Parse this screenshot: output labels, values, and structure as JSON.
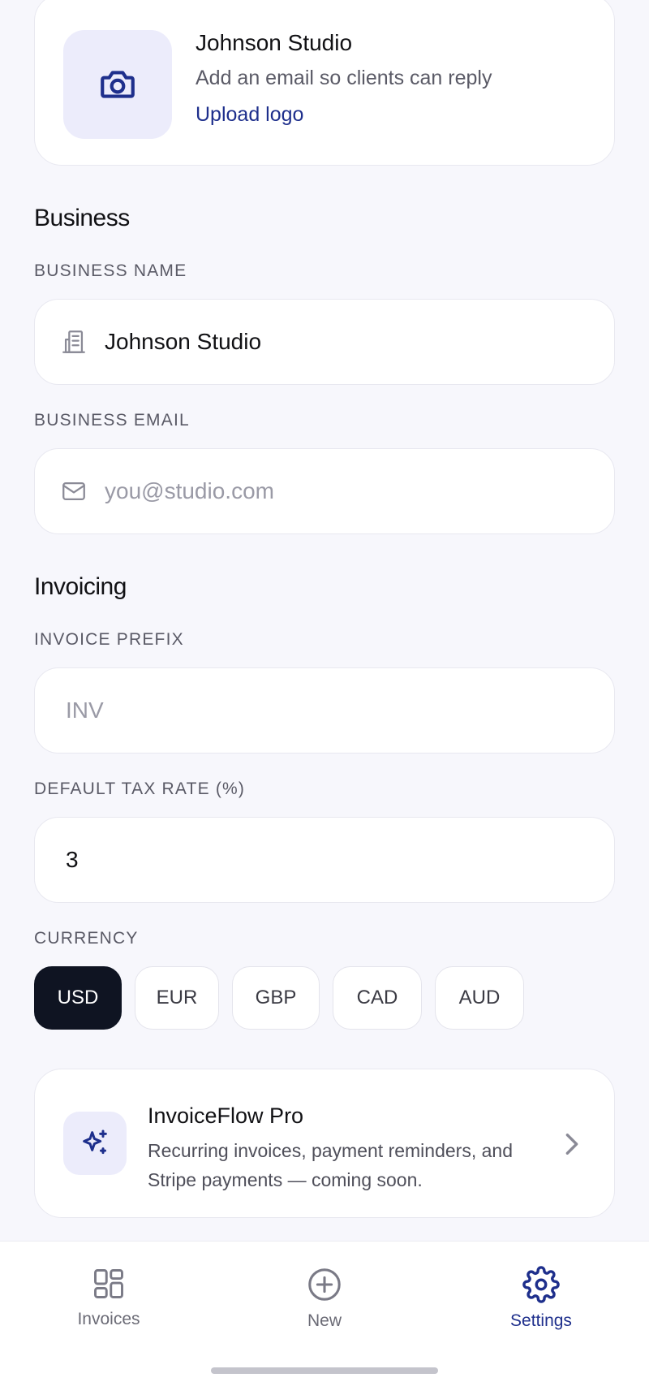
{
  "profile": {
    "name": "Johnson Studio",
    "subtitle": "Add an email so clients can reply",
    "upload_label": "Upload logo",
    "icon": "camera-icon"
  },
  "business": {
    "section_title": "Business",
    "name_label": "BUSINESS NAME",
    "name_value": "Johnson Studio",
    "name_icon": "building-icon",
    "email_label": "BUSINESS EMAIL",
    "email_value": "",
    "email_placeholder": "you@studio.com",
    "email_icon": "mail-icon"
  },
  "invoicing": {
    "section_title": "Invoicing",
    "prefix_label": "INVOICE PREFIX",
    "prefix_value": "",
    "prefix_placeholder": "INV",
    "tax_label": "DEFAULT TAX RATE (%)",
    "tax_value": "3",
    "currency_label": "CURRENCY",
    "currencies": [
      "USD",
      "EUR",
      "GBP",
      "CAD",
      "AUD"
    ],
    "selected_currency": "USD"
  },
  "pro": {
    "title": "InvoiceFlow Pro",
    "description": "Recurring invoices, payment reminders, and Stripe payments — coming soon.",
    "icon": "sparkle-icon"
  },
  "tabbar": {
    "tabs": [
      {
        "label": "Invoices",
        "icon": "grid-icon",
        "active": false
      },
      {
        "label": "New",
        "icon": "plus-circle-icon",
        "active": false
      },
      {
        "label": "Settings",
        "icon": "gear-icon",
        "active": true
      }
    ]
  },
  "colors": {
    "background": "#F7F7FC",
    "accent": "#1E2F8C",
    "selected_chip": "#0F1422",
    "icon_tile": "#ECECFB"
  }
}
